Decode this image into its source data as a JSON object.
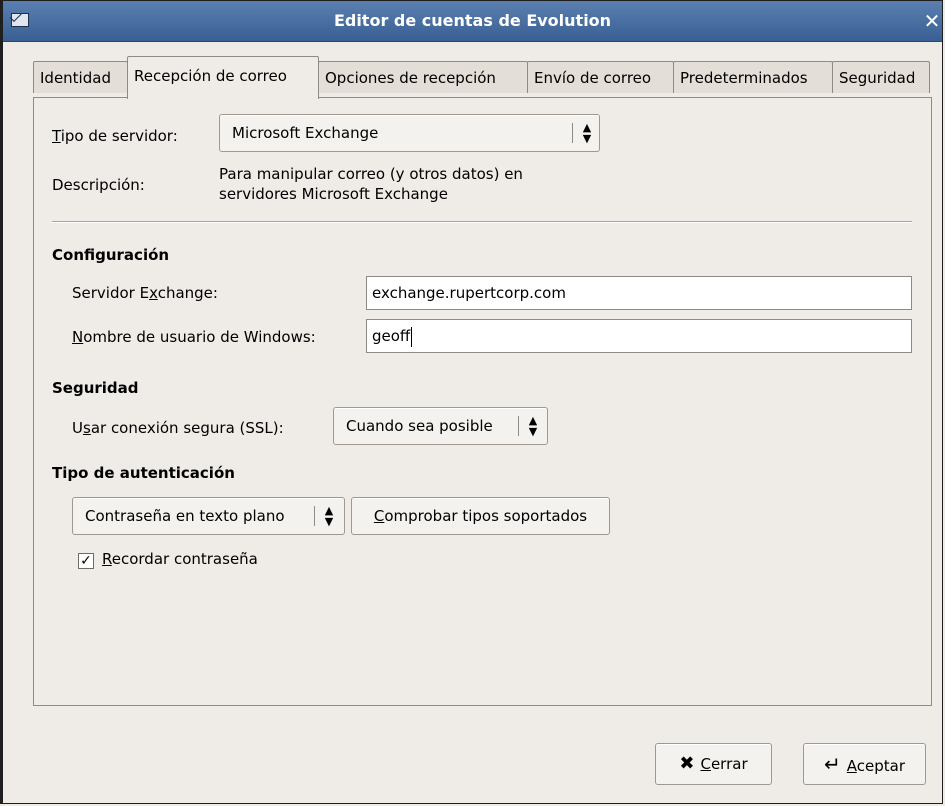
{
  "window": {
    "title": "Editor de cuentas de Evolution"
  },
  "tabs": [
    {
      "label": "Identidad"
    },
    {
      "label": "Recepción de correo"
    },
    {
      "label": "Opciones de recepción"
    },
    {
      "label": "Envío de correo"
    },
    {
      "label": "Predeterminados"
    },
    {
      "label": "Seguridad"
    }
  ],
  "server": {
    "type_label_underline": "T",
    "type_label_rest": "ipo de servidor:",
    "type_value": "Microsoft Exchange",
    "desc_label": "Descripción:",
    "desc_line1": "Para manipular correo (y otros datos) en",
    "desc_line2": "servidores Microsoft Exchange"
  },
  "config": {
    "heading": "Configuración",
    "exchange_label_pre": "Servidor E",
    "exchange_label_u": "x",
    "exchange_label_post": "change:",
    "exchange_value": "exchange.rupertcorp.com",
    "user_label_u": "N",
    "user_label_post": "ombre de usuario de Windows:",
    "user_value": "geoff"
  },
  "security": {
    "heading": "Seguridad",
    "ssl_label_pre": "U",
    "ssl_label_u": "s",
    "ssl_label_post": "ar conexión segura (SSL):",
    "ssl_value": "Cuando sea posible"
  },
  "auth": {
    "heading": "Tipo de autenticación",
    "type_value": "Contraseña en texto plano",
    "check_button_u": "C",
    "check_button_post": "omprobar tipos soportados",
    "remember_checked": true,
    "remember_u": "R",
    "remember_post": "ecordar contraseña"
  },
  "buttons": {
    "close_u": "C",
    "close_post": "errar",
    "accept_u": "A",
    "accept_post": "ceptar"
  }
}
